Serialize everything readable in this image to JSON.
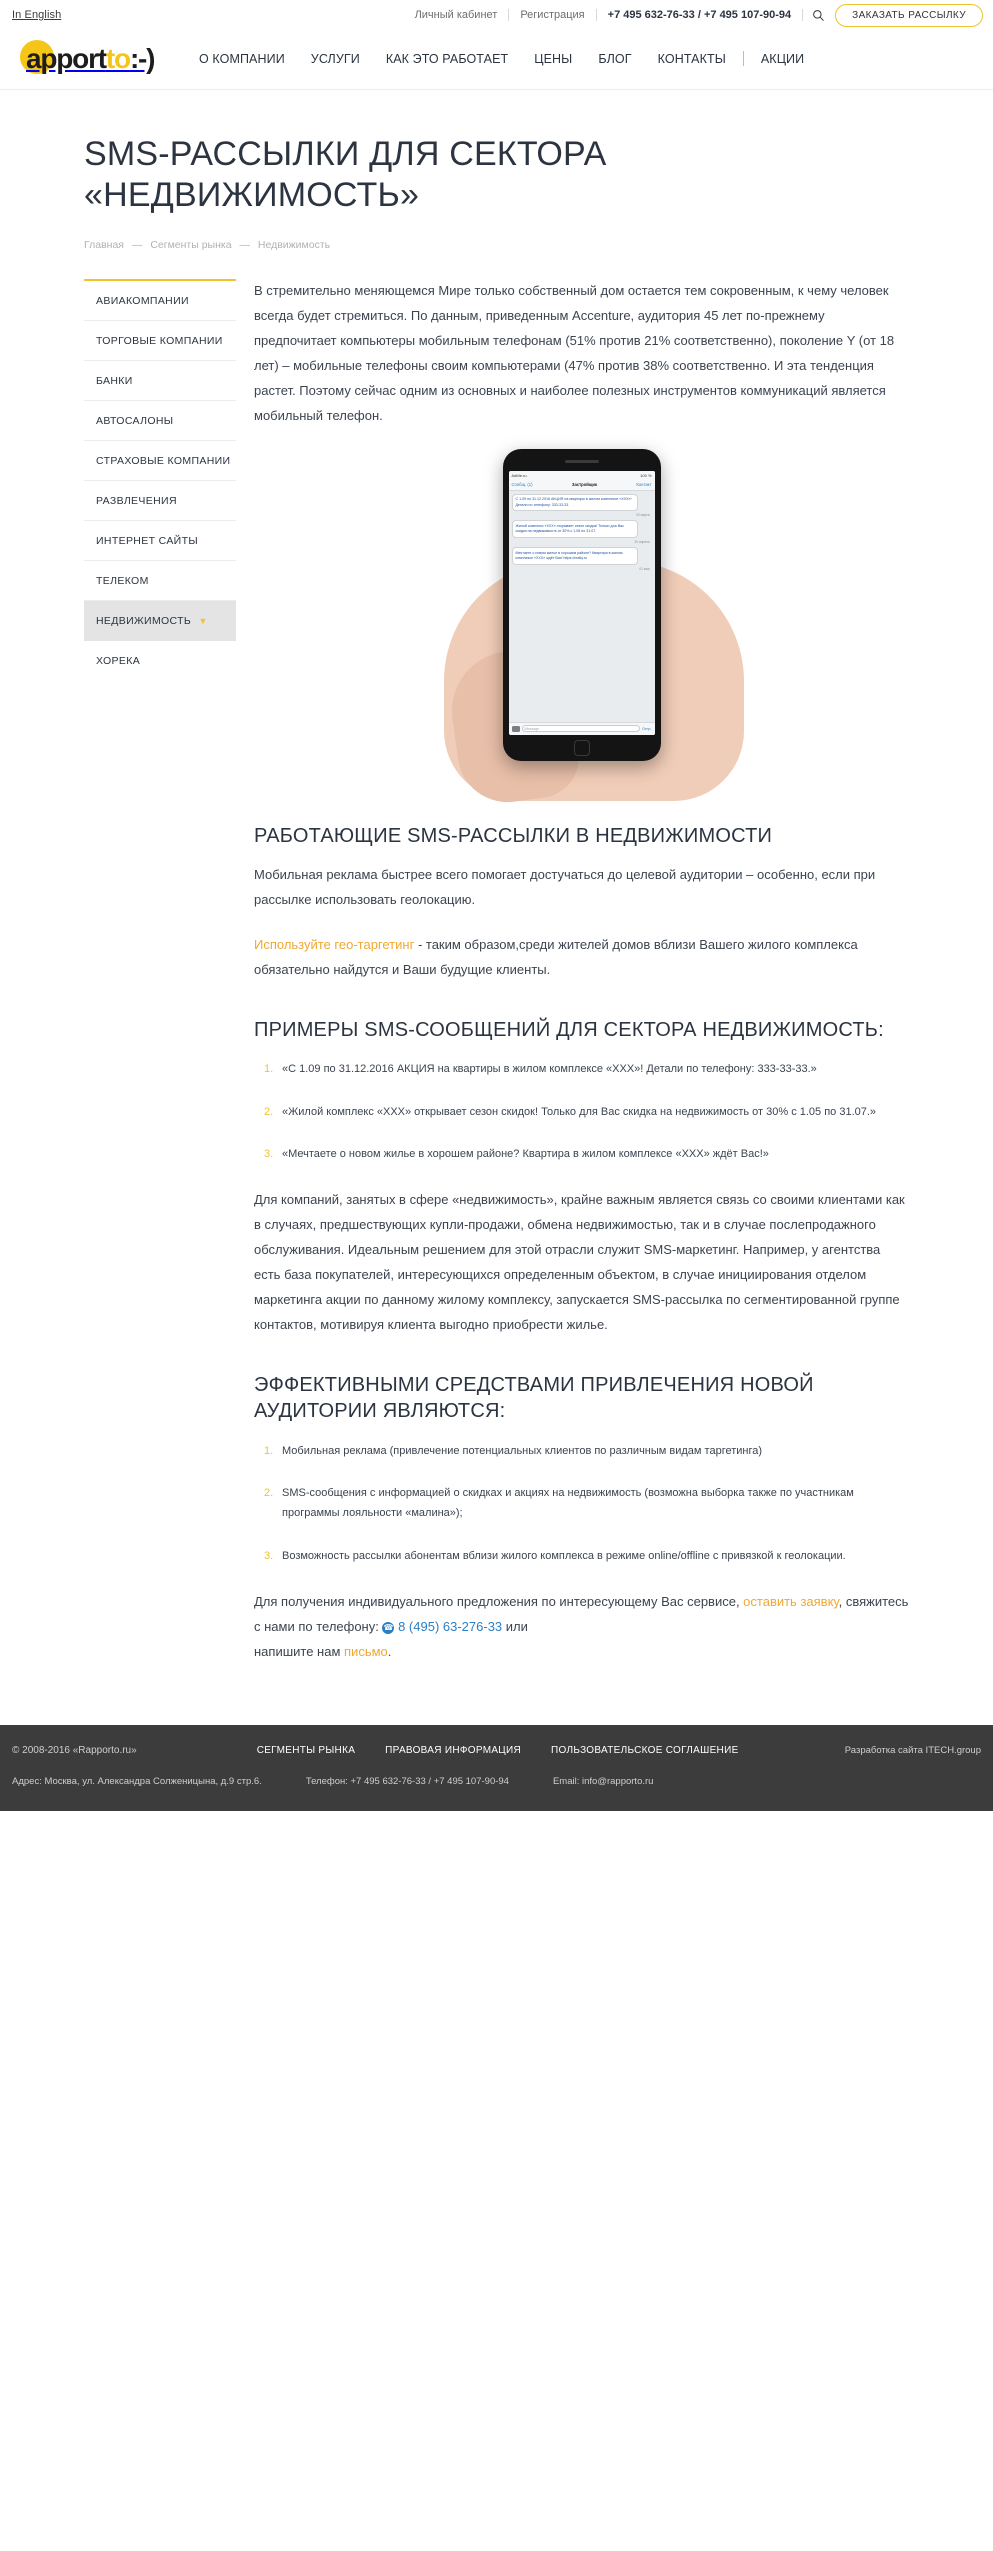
{
  "topbar": {
    "lang": "In English",
    "account": "Личный кабинет",
    "register": "Регистрация",
    "phones": "+7 495 632-76-33 / +7 495 107-90-94",
    "search_icon": "search-icon",
    "order_button": "ЗАКАЗАТЬ РАССЫЛКУ"
  },
  "logo": {
    "part1": "r",
    "part2": "apport",
    "part3": "to",
    "part4": ":-)",
    "alt": "rapporto"
  },
  "nav": [
    {
      "label": "О КОМПАНИИ"
    },
    {
      "label": "УСЛУГИ"
    },
    {
      "label": "КАК ЭТО РАБОТАЕТ"
    },
    {
      "label": "ЦЕНЫ"
    },
    {
      "label": "БЛОГ"
    },
    {
      "label": "КОНТАКТЫ"
    },
    {
      "label": "АКЦИИ"
    }
  ],
  "hero": {
    "title_line1": "SMS-РАССЫЛКИ ДЛЯ СЕКТОРА",
    "title_line2": "«НЕДВИЖИМОСТЬ»"
  },
  "breadcrumb": {
    "home": "Главная",
    "sep": "—",
    "segments": "Сегменты рынка",
    "current": "Недвижимость"
  },
  "sidebar": {
    "items": [
      {
        "label": "АВИАКОМПАНИИ",
        "active": false
      },
      {
        "label": "ТОРГОВЫЕ КОМПАНИИ",
        "active": false
      },
      {
        "label": "БАНКИ",
        "active": false
      },
      {
        "label": "АВТОСАЛОНЫ",
        "active": false
      },
      {
        "label": "СТРАХОВЫЕ КОМПАНИИ",
        "active": false
      },
      {
        "label": "РАЗВЛЕЧЕНИЯ",
        "active": false
      },
      {
        "label": "ИНТЕРНЕТ САЙТЫ",
        "active": false
      },
      {
        "label": "ТЕЛЕКОМ",
        "active": false
      },
      {
        "label": "НЕДВИЖИМОСТЬ",
        "active": true
      },
      {
        "label": "ХОРЕКА",
        "active": false
      }
    ],
    "active_chevron": "chevron-down-icon"
  },
  "content": {
    "intro": "В стремительно меняющемся Мире только собственный дом остается тем сокровенным, к чему человек всегда будет стремиться. По данным, приведенным Accenture, аудитория 45 лет по-прежнему предпочитает компьютеры мобильным телефонам (51% против 21% соответственно), поколение Y (от 18 лет) – мобильные телефоны своим компьютерами (47% против 38% соответственно. И эта тенденция растет. Поэтому сейчас одним из основных и наиболее полезных инструментов коммуникаций является мобильный телефон.",
    "h2_working": "РАБОТАЮЩИЕ SMS-РАССЫЛКИ В НЕДВИЖИМОСТИ",
    "p_working": "Мобильная реклама быстрее всего помогает достучаться до целевой аудитории – особенно, если при рассылке использовать геолокацию.",
    "p_geo_link": "Используйте гео-таргетинг",
    "p_geo_rest": " - таким образом,среди жителей домов вблизи Вашего жилого комплекса обязательно найдутся и Ваши будущие клиенты.",
    "h2_examples": "ПРИМЕРЫ SMS-СООБЩЕНИЙ ДЛЯ СЕКТОРА НЕДВИЖИМОСТЬ:",
    "examples": [
      "«С 1.09 по 31.12.2016 АКЦИЯ на квартиры в жилом комплексе «ХХХ»! Детали по телефону: 333-33-33.»",
      "«Жилой комплекс «ХХХ» открывает сезон скидок! Только для Вас скидка на недвижимость от 30% с 1.05 по 31.07.»",
      "«Мечтаете о новом жилье в хорошем районе? Квартира в жилом комплексе «ХХХ» ждёт Вас!»"
    ],
    "p_long": "Для компаний, занятых в сфере «недвижимость», крайне важным является связь со своими клиентами как в случаях, предшествующих купли-продажи, обмена недвижимостью, так и в случае послепродажного обслуживания. Идеальным решением для этой отрасли служит SMS-маркетинг. Например, у агентства есть база покупателей, интересующихся определенным объектом, в случае инициирования отделом маркетинга акции по данному жилому комплексу, запускается SMS-рассылка по сегментированной группе контактов, мотивируя клиента выгодно приобрести жилье.",
    "h2_effective": "ЭФФЕКТИВНЫМИ СРЕДСТВАМИ ПРИВЛЕЧЕНИЯ НОВОЙ АУДИТОРИИ ЯВЛЯЮТСЯ:",
    "effective": [
      "Мобильная реклама (привлечение потенциальных клиентов по различным видам таргетинга)",
      "SMS-сообщения с информацией о скидках и акциях на недвижимость (возможна выборка также по участникам программы лояльности «малина»);",
      "Возможность рассылки абонентам вблизи жилого комплекса в режиме online/offline с привязкой к геолокации."
    ],
    "cta_pre": "Для получения индивидуального предложения по интересующему Вас сервисе, ",
    "cta_link1": "оставить заявку",
    "cta_mid": ", свяжитесь с нами по телефону: ",
    "cta_phone": "8 (495) 63-276-33",
    "cta_or": " или",
    "cta_tail": "напишите нам ",
    "cta_link2": "письмо",
    "cta_end": ".",
    "phone_icon": "phone-circle-icon"
  },
  "phone_mock": {
    "status_left": "Билайн",
    "status_carrier": "AdMe.ru",
    "status_right": "100 %",
    "tab_left": "Сообщ. (1)",
    "tab_mid": "Застройщик",
    "tab_right": "Контакт",
    "messages": [
      {
        "text": "С 1.09 по 31.12.2016 АКЦИЯ на квартиры в жилом комплексе «ХХХ»! Детали по телефону: 333-33-33.",
        "highlight": true,
        "date": "02 марта"
      },
      {
        "text": "Жилой комплекс «ХХХ» открывает сезон скидок! Только для Вас скидка на недвижимость от 30% с 1.05 по 31.07.",
        "highlight": true,
        "date": "20 апреля"
      },
      {
        "text": "Мечтаете о новом жилье в хорошем районе? Квартира в жилом комплексе «ХХХ» ждёт Вас! https://realty.ru",
        "highlight": true,
        "date": "01 мая"
      }
    ],
    "composer_placeholder": "iMessage",
    "send_label": "Отпр.",
    "camera_icon": "camera-icon"
  },
  "footer": {
    "copyright": "© 2008-2016 «Rapporto.ru»",
    "links": [
      {
        "label": "СЕГМЕНТЫ РЫНКА"
      },
      {
        "label": "ПРАВОВАЯ ИНФОРМАЦИЯ"
      },
      {
        "label": "ПОЛЬЗОВАТЕЛЬСКОЕ СОГЛАШЕНИЕ"
      }
    ],
    "developer": "Разработка сайта ITECH.group",
    "address": "Адрес: Москва, ул. Александра Солженицына, д.9 стр.6.",
    "phone": "Телефон: +7 495 632-76-33 / +7 495 107-90-94",
    "email": "Email: info@rapporto.ru"
  },
  "colors": {
    "accent": "#f0c330",
    "dark": "#2b3440",
    "footer_bg": "#3c3c3c",
    "link_blue": "#2b7fc4",
    "link_orange": "#f0a830"
  }
}
